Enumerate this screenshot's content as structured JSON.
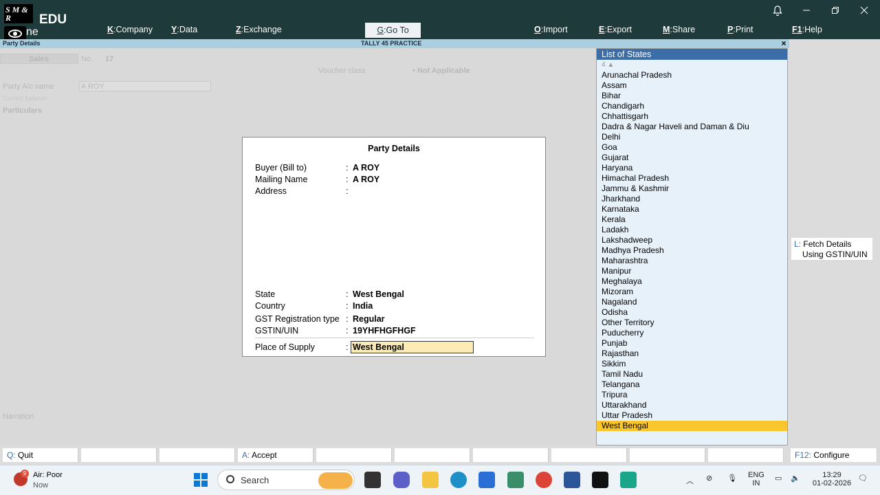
{
  "topbar": {
    "logo_text": "S M & R",
    "logo_partial": "ne",
    "brand": "EDU",
    "menu": [
      {
        "key": "K",
        "label": "Company"
      },
      {
        "key": "Y",
        "label": "Data"
      },
      {
        "key": "Z",
        "label": "Exchange"
      },
      {
        "key": "G",
        "label": "Go To"
      },
      {
        "key": "O",
        "label": "Import"
      },
      {
        "key": "E",
        "label": "Export"
      },
      {
        "key": "M",
        "label": "Share"
      },
      {
        "key": "P",
        "label": "Print"
      },
      {
        "key": "F1",
        "label": "Help"
      }
    ]
  },
  "screen": {
    "left_title": "Party Details",
    "center_title": "TALLY 45 PRACTICE",
    "close": "×"
  },
  "voucher": {
    "type": "Sales",
    "no_label": "No.",
    "no_value": "17",
    "voucher_class_label": "Voucher class",
    "voucher_class_value": "Not Applicable",
    "party_label": "Party A/c name",
    "party_value": "A ROY",
    "current_balance": "Current balance",
    "particulars": "Particulars",
    "narration": "Narration"
  },
  "party_details": {
    "title": "Party Details",
    "buyer_label": "Buyer (Bill to)",
    "buyer_value": "A ROY",
    "mailing_label": "Mailing Name",
    "mailing_value": "A ROY",
    "address_label": "Address",
    "state_label": "State",
    "state_value": "West Bengal",
    "country_label": "Country",
    "country_value": "India",
    "gst_type_label": "GST Registration type",
    "gst_type_value": "Regular",
    "gstin_label": "GSTIN/UIN",
    "gstin_value": "19YHFHGFHGF",
    "pos_label": "Place of Supply",
    "pos_value": "West Bengal",
    "colon": ":"
  },
  "states": {
    "title": "List of States",
    "count": "4 ▲",
    "items": [
      "Arunachal Pradesh",
      "Assam",
      "Bihar",
      "Chandigarh",
      "Chhattisgarh",
      "Dadra & Nagar Haveli and Daman & Diu",
      "Delhi",
      "Goa",
      "Gujarat",
      "Haryana",
      "Himachal Pradesh",
      "Jammu & Kashmir",
      "Jharkhand",
      "Karnataka",
      "Kerala",
      "Ladakh",
      "Lakshadweep",
      "Madhya Pradesh",
      "Maharashtra",
      "Manipur",
      "Meghalaya",
      "Mizoram",
      "Nagaland",
      "Odisha",
      "Other Territory",
      "Puducherry",
      "Punjab",
      "Rajasthan",
      "Sikkim",
      "Tamil Nadu",
      "Telangana",
      "Tripura",
      "Uttarakhand",
      "Uttar Pradesh",
      "West Bengal"
    ],
    "selected": "West Bengal"
  },
  "side_buttons": {
    "fetch_key": "L:",
    "fetch_line1": "Fetch Details",
    "fetch_line2": "Using GSTIN/UIN"
  },
  "keybar": {
    "quit_key": "Q:",
    "quit_label": "Quit",
    "accept_key": "A:",
    "accept_label": "Accept",
    "configure_key": "F12:",
    "configure_label": "Configure"
  },
  "taskbar": {
    "weather_badge": "9",
    "weather_title": "Air: Poor",
    "weather_sub": "Now",
    "search_placeholder": "Search",
    "lang_top": "ENG",
    "lang_bottom": "IN",
    "time": "13:29",
    "date": "01-02-2026"
  },
  "colors": {
    "topbar": "#1f3a3a",
    "list_header": "#3b6ea8",
    "selection": "#f9c62b",
    "input_bg": "#fcebb4"
  }
}
